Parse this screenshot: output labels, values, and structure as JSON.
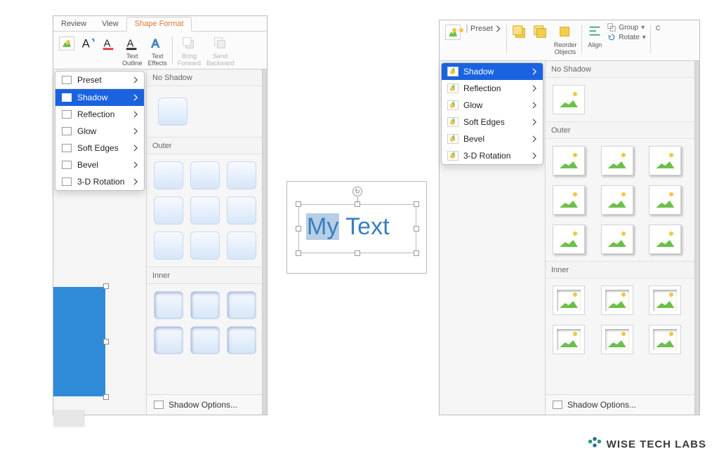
{
  "tabs": {
    "review": "Review",
    "view": "View",
    "shape_format": "Shape Format"
  },
  "ribbon_left": {
    "text_outline": "Text\nOutline",
    "text_effects": "Text\nEffects",
    "bring_forward": "Bring\nForward",
    "send_backward": "Send\nBackward"
  },
  "ribbon_right": {
    "preset": "Preset",
    "reorder": "Reorder\nObjects",
    "align": "Align",
    "group": "Group",
    "rotate": "Rotate",
    "c": "C"
  },
  "menu": {
    "preset": "Preset",
    "shadow": "Shadow",
    "reflection": "Reflection",
    "glow": "Glow",
    "soft_edges": "Soft Edges",
    "bevel": "Bevel",
    "rotation": "3-D Rotation"
  },
  "gallery": {
    "no_shadow": "No Shadow",
    "outer": "Outer",
    "inner": "Inner",
    "options": "Shadow Options..."
  },
  "textbox": {
    "line1": "My",
    "line2": " Text",
    "rotate_glyph": "↻"
  },
  "brand": "WISE TECH LABS"
}
